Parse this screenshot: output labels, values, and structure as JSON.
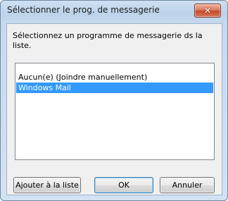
{
  "dialog": {
    "title": "Sélectionner le prog. de messagerie",
    "close_label": "✕",
    "instruction": "Sélectionnez un programme de messagerie ds la liste."
  },
  "list": {
    "items": [
      {
        "label": "Aucun(e) (Joindre manuellement)",
        "selected": false
      },
      {
        "label": "Windows Mail",
        "selected": true
      }
    ]
  },
  "buttons": {
    "add_label": "Ajouter à la liste",
    "ok_label": "OK",
    "cancel_label": "Annuler"
  },
  "colors": {
    "selection": "#3399ff",
    "close_button": "#c14a2a"
  }
}
